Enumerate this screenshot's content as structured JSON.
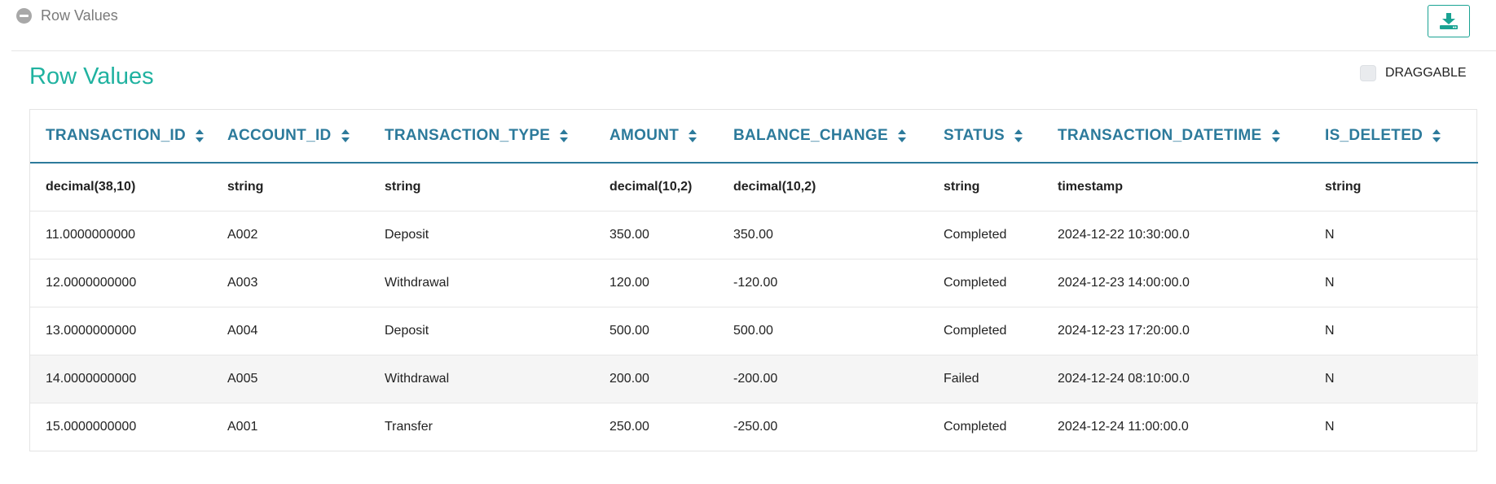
{
  "panel": {
    "collapse_label": "Row Values",
    "title": "Row Values",
    "draggable_label": "DRAGGABLE",
    "draggable_checked": false,
    "accent_color": "#20b2a0",
    "header_color": "#2c7a9b",
    "icons": {
      "collapse": "minus-circle-icon",
      "download": "download-icon",
      "sort": "sort-icon"
    }
  },
  "table": {
    "columns": [
      "TRANSACTION_ID",
      "ACCOUNT_ID",
      "TRANSACTION_TYPE",
      "AMOUNT",
      "BALANCE_CHANGE",
      "STATUS",
      "TRANSACTION_DATETIME",
      "IS_DELETED"
    ],
    "types": [
      "decimal(38,10)",
      "string",
      "string",
      "decimal(10,2)",
      "decimal(10,2)",
      "string",
      "timestamp",
      "string"
    ],
    "rows": [
      [
        "11.0000000000",
        "A002",
        "Deposit",
        "350.00",
        "350.00",
        "Completed",
        "2024-12-22 10:30:00.0",
        "N"
      ],
      [
        "12.0000000000",
        "A003",
        "Withdrawal",
        "120.00",
        "-120.00",
        "Completed",
        "2024-12-23 14:00:00.0",
        "N"
      ],
      [
        "13.0000000000",
        "A004",
        "Deposit",
        "500.00",
        "500.00",
        "Completed",
        "2024-12-23 17:20:00.0",
        "N"
      ],
      [
        "14.0000000000",
        "A005",
        "Withdrawal",
        "200.00",
        "-200.00",
        "Failed",
        "2024-12-24 08:10:00.0",
        "N"
      ],
      [
        "15.0000000000",
        "A001",
        "Transfer",
        "250.00",
        "-250.00",
        "Completed",
        "2024-12-24 11:00:00.0",
        "N"
      ]
    ]
  }
}
